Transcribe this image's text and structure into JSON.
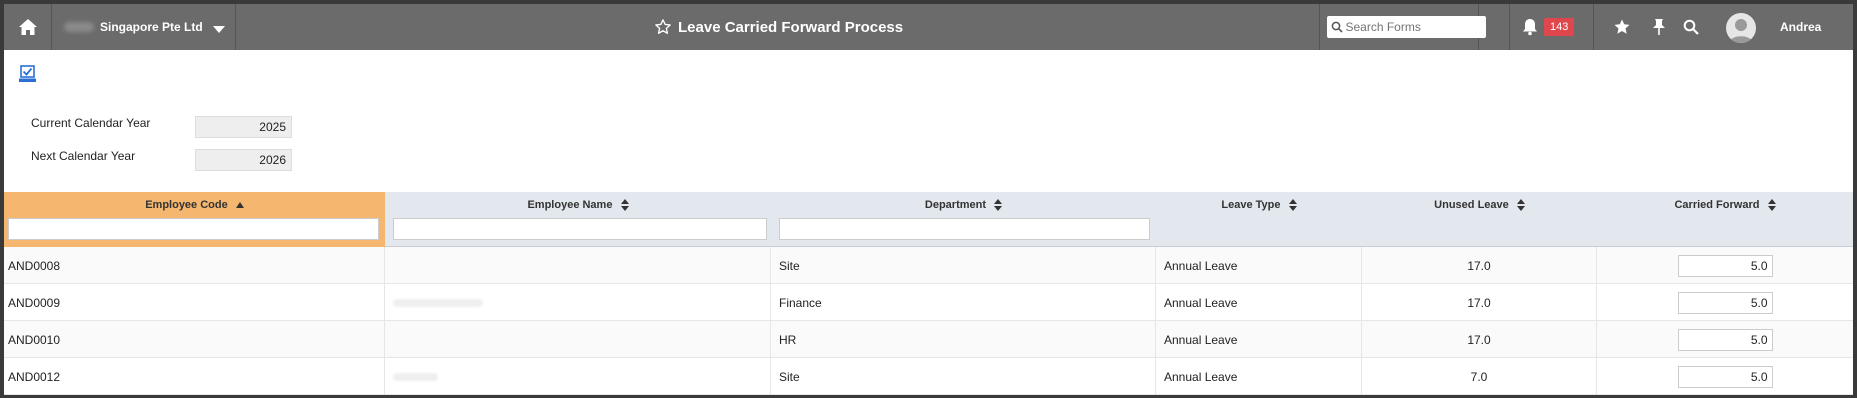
{
  "header": {
    "company": "Singapore Pte Ltd",
    "title": "Leave Carried Forward Process",
    "search_placeholder": "Search Forms",
    "notification_count": "143",
    "user_name": "Andrea",
    "icons": [
      "home-icon",
      "caret-down-icon",
      "star-outline-icon",
      "search-icon",
      "bell-icon",
      "star-icon",
      "pin-icon",
      "magnify-icon",
      "avatar-icon"
    ]
  },
  "form": {
    "current_year_label": "Current Calendar Year",
    "current_year_value": "2025",
    "next_year_label": "Next Calendar Year",
    "next_year_value": "2026"
  },
  "table": {
    "columns": [
      "Employee Code",
      "Employee Name",
      "Department",
      "Leave Type",
      "Unused Leave",
      "Carried Forward"
    ],
    "sorted_column": "Employee Code",
    "rows": [
      {
        "code": "AND0008",
        "name": "",
        "department": "Site",
        "leave_type": "Annual Leave",
        "unused": "17.0",
        "carried": "5.0"
      },
      {
        "code": "AND0009",
        "name": "",
        "department": "Finance",
        "leave_type": "Annual Leave",
        "unused": "17.0",
        "carried": "5.0"
      },
      {
        "code": "AND0010",
        "name": "",
        "department": "HR",
        "leave_type": "Annual Leave",
        "unused": "17.0",
        "carried": "5.0"
      },
      {
        "code": "AND0012",
        "name": "",
        "department": "Site",
        "leave_type": "Annual Leave",
        "unused": "7.0",
        "carried": "5.0"
      }
    ]
  },
  "colors": {
    "topbar": "#6b6b6b",
    "active_header": "#f5b66f",
    "header_bg": "#e3e7ee",
    "badge": "#e0474c",
    "accent_icon": "#2a6fd6"
  }
}
